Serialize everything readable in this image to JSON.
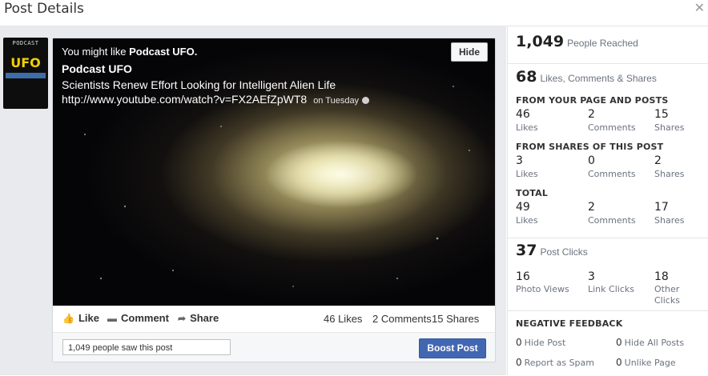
{
  "dialog": {
    "title": "Post Details",
    "close_icon": "close-icon"
  },
  "avatar": {
    "top_text": "PODCAST",
    "logo_text": "UFO"
  },
  "post": {
    "suggest_prefix": "You might like ",
    "suggest_page": "Podcast UFO.",
    "page_name": "Podcast UFO",
    "headline": "Scientists Renew Effort Looking for Intelligent Alien Life",
    "url": "http://www.youtube.com/watch?v=FX2AEfZpWT8",
    "date": "on Tuesday",
    "hide_label": "Hide"
  },
  "actions": {
    "like": "Like",
    "comment": "Comment",
    "share": "Share",
    "likes_count": "46 Likes",
    "comments_count": "2 Comments",
    "shares_count": "15 Shares"
  },
  "footer": {
    "saw_text": "1,049 people saw this post",
    "boost_label": "Boost Post"
  },
  "stats": {
    "reached": {
      "value": "1,049",
      "label": "People Reached"
    },
    "engagement": {
      "value": "68",
      "label": "Likes, Comments & Shares"
    },
    "from_page": {
      "title": "FROM YOUR PAGE AND POSTS",
      "likes": "46",
      "comments": "2",
      "shares": "15"
    },
    "from_shares": {
      "title": "FROM SHARES OF THIS POST",
      "likes": "3",
      "comments": "0",
      "shares": "2"
    },
    "total": {
      "title": "TOTAL",
      "likes": "49",
      "comments": "2",
      "shares": "17"
    },
    "labels": {
      "likes": "Likes",
      "comments": "Comments",
      "shares": "Shares"
    },
    "clicks": {
      "value": "37",
      "label": "Post Clicks",
      "photo_views": "16",
      "photo_views_label": "Photo Views",
      "link_clicks": "3",
      "link_clicks_label": "Link Clicks",
      "other": "18",
      "other_label_1": "Other",
      "other_label_2": "Clicks"
    },
    "negative": {
      "title": "NEGATIVE FEEDBACK",
      "hide_post": "0",
      "hide_post_label": "Hide Post",
      "hide_all": "0",
      "hide_all_label": "Hide All Posts",
      "spam": "0",
      "spam_label": "Report as Spam",
      "unlike": "0",
      "unlike_label": "Unlike Page"
    }
  },
  "colors": {
    "boost": "#4267b2",
    "panel_bg": "#e9eaed",
    "accent_text": "#6b7280"
  }
}
